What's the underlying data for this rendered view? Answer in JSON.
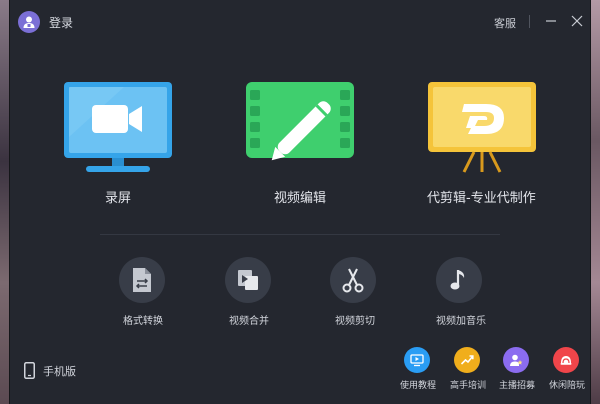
{
  "titlebar": {
    "login_label": "登录",
    "service_label": "客服",
    "minimize_icon": "minimize-icon",
    "close_icon": "close-icon"
  },
  "main_features": [
    {
      "label": "录屏",
      "icon": "monitor-camera-icon",
      "color": "#35a4e9"
    },
    {
      "label": "视频编辑",
      "icon": "film-pen-icon",
      "color": "#3fcf6e"
    },
    {
      "label": "代剪辑-专业代制作",
      "icon": "easel-logo-icon",
      "color": "#f5c43a"
    }
  ],
  "tools": [
    {
      "label": "格式转换",
      "icon": "file-convert-icon"
    },
    {
      "label": "视频合并",
      "icon": "video-merge-icon"
    },
    {
      "label": "视频剪切",
      "icon": "scissors-icon"
    },
    {
      "label": "视频加音乐",
      "icon": "music-note-icon"
    }
  ],
  "bottom": {
    "mobile_label": "手机版",
    "links": [
      {
        "label": "使用教程",
        "icon": "tutorial-icon",
        "color": "#2a9df4"
      },
      {
        "label": "高手培训",
        "icon": "trend-icon",
        "color": "#f0ae1c"
      },
      {
        "label": "主播招募",
        "icon": "recruit-icon",
        "color": "#8b6cf0"
      },
      {
        "label": "休闲陪玩",
        "icon": "leisure-icon",
        "color": "#f0454a"
      }
    ]
  }
}
